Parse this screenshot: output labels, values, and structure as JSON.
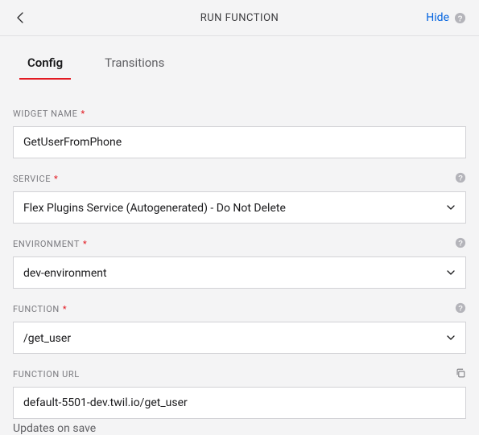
{
  "header": {
    "title": "RUN FUNCTION",
    "hide_label": "Hide"
  },
  "tabs": {
    "config": "Config",
    "transitions": "Transitions"
  },
  "fields": {
    "widget_name": {
      "label": "WIDGET NAME",
      "required": "*",
      "value": "GetUserFromPhone"
    },
    "service": {
      "label": "SERVICE",
      "required": "*",
      "value": "Flex Plugins Service (Autogenerated) - Do Not Delete"
    },
    "environment": {
      "label": "ENVIRONMENT",
      "required": "*",
      "value": "dev-environment"
    },
    "function": {
      "label": "FUNCTION",
      "required": "*",
      "value": "/get_user"
    },
    "function_url": {
      "label": "FUNCTION URL",
      "value": "default-5501-dev.twil.io/get_user",
      "hint": "Updates on save"
    }
  }
}
